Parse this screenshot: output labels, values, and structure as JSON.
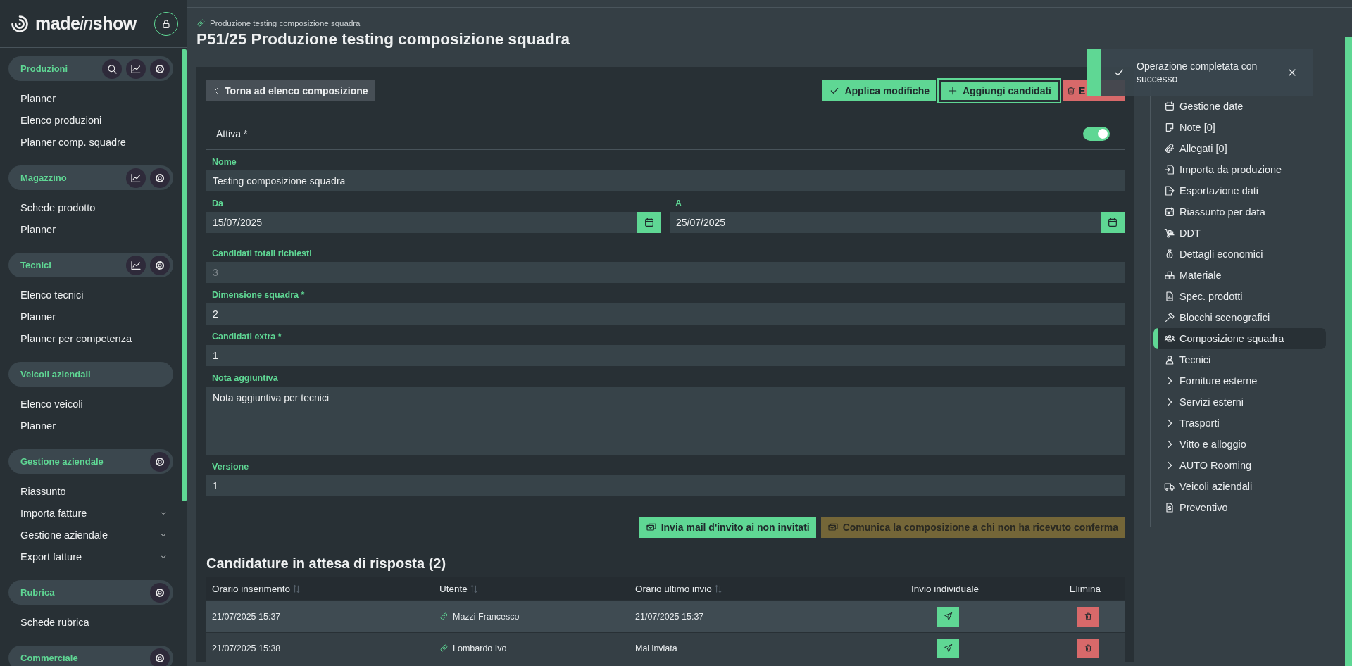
{
  "sidebar": {
    "logo": [
      {
        "text": "made",
        "italic": false
      },
      {
        "text": "in",
        "italic": true
      },
      {
        "text": "show",
        "italic": false
      }
    ],
    "sections": [
      {
        "title": "Produzioni",
        "actions": [
          {
            "kind": "search"
          },
          {
            "kind": "chart"
          },
          {
            "kind": "settings"
          }
        ],
        "items": [
          {
            "label": "Planner",
            "expandable": false
          },
          {
            "label": "Elenco produzioni",
            "expandable": false
          },
          {
            "label": "Planner comp. squadre",
            "expandable": false
          }
        ]
      },
      {
        "title": "Magazzino",
        "actions": [
          {
            "kind": "chart"
          },
          {
            "kind": "settings"
          }
        ],
        "items": [
          {
            "label": "Schede prodotto",
            "expandable": false
          },
          {
            "label": "Planner",
            "expandable": false
          }
        ]
      },
      {
        "title": "Tecnici",
        "actions": [
          {
            "kind": "chart"
          },
          {
            "kind": "settings"
          }
        ],
        "items": [
          {
            "label": "Elenco tecnici",
            "expandable": false
          },
          {
            "label": "Planner",
            "expandable": false
          },
          {
            "label": "Planner per competenza",
            "expandable": false
          }
        ]
      },
      {
        "title": "Veicoli aziendali",
        "items": [
          {
            "label": "Elenco veicoli",
            "expandable": false
          },
          {
            "label": "Planner",
            "expandable": false
          }
        ]
      },
      {
        "title": "Gestione aziendale",
        "actions": [
          {
            "kind": "settings"
          }
        ],
        "items": [
          {
            "label": "Riassunto",
            "expandable": false
          },
          {
            "label": "Importa fatture",
            "expandable": true
          },
          {
            "label": "Gestione aziendale",
            "expandable": true
          },
          {
            "label": "Export fatture",
            "expandable": true
          }
        ]
      },
      {
        "title": "Rubrica",
        "actions": [
          {
            "kind": "settings"
          }
        ],
        "items": [
          {
            "label": "Schede rubrica",
            "expandable": false
          }
        ]
      },
      {
        "title": "Commerciale",
        "actions": [
          {
            "kind": "settings"
          }
        ]
      }
    ]
  },
  "breadcrumb": "Produzione testing composizione squadra",
  "title": "P51/25 Produzione testing composizione squadra",
  "back_button": "Torna ad elenco composizione",
  "actions": [
    {
      "kind": "apply",
      "label": "Applica modifiche"
    },
    {
      "kind": "add",
      "label": "Aggiungi candidati"
    },
    {
      "kind": "delete",
      "label": "E"
    }
  ],
  "toggle": {
    "label": "Attiva *",
    "on": true
  },
  "fields": [
    {
      "kind": "text",
      "label": "Nome",
      "value": "Testing composizione squadra",
      "disabled": false
    },
    {
      "kind": "dates",
      "items": [
        {
          "label": "Da",
          "value": "15/07/2025"
        },
        {
          "label": "A",
          "value": "25/07/2025"
        }
      ]
    },
    {
      "kind": "text",
      "label": "Candidati totali richiesti",
      "value": "3",
      "disabled": true
    },
    {
      "kind": "text",
      "label": "Dimensione squadra *",
      "value": "2",
      "disabled": false
    },
    {
      "kind": "text",
      "label": "Candidati extra *",
      "value": "1",
      "disabled": false
    },
    {
      "kind": "textarea",
      "label": "Nota aggiuntiva",
      "value": "Nota aggiuntiva per tecnici",
      "disabled": false
    },
    {
      "kind": "text",
      "label": "Versione",
      "value": "1",
      "disabled": false
    }
  ],
  "mail_buttons": [
    {
      "kind": "invite",
      "label": "Invia mail d'invito ai non invitati"
    },
    {
      "kind": "notify",
      "label": "Comunica la composizione a chi non ha ricevuto conferma"
    }
  ],
  "table": {
    "title": "Candidature in attesa di risposta (2)",
    "columns": [
      {
        "label": "Orario inserimento",
        "sortable": true
      },
      {
        "label": "Utente",
        "sortable": true
      },
      {
        "label": "Orario ultimo invio",
        "sortable": true
      },
      {
        "label": "Invio individuale",
        "sortable": false
      },
      {
        "label": "Elimina",
        "sortable": false
      }
    ],
    "rows": [
      {
        "inserted": "21/07/2025 15:37",
        "user": "Mazzi Francesco",
        "last_sent": "21/07/2025 15:37",
        "hovered": true
      },
      {
        "inserted": "21/07/2025 15:38",
        "user": "Lombardo Ivo",
        "last_sent": "Mai inviata",
        "hovered": false
      }
    ]
  },
  "side_nav": [
    {
      "kind": "page",
      "label": "Gestione date",
      "selected": false
    },
    {
      "kind": "page",
      "label": "Note [0]",
      "selected": false
    },
    {
      "kind": "page",
      "label": "Allegati [0]",
      "selected": false
    },
    {
      "kind": "page",
      "label": "Importa da produzione",
      "selected": false
    },
    {
      "kind": "page",
      "label": "Esportazione dati",
      "selected": false
    },
    {
      "kind": "page",
      "label": "Riassunto per data",
      "selected": false
    },
    {
      "kind": "page",
      "label": "DDT",
      "selected": false
    },
    {
      "kind": "page",
      "label": "Dettagli economici",
      "selected": false
    },
    {
      "kind": "page",
      "label": "Materiale",
      "selected": false
    },
    {
      "kind": "page",
      "label": "Spec. prodotti",
      "selected": false
    },
    {
      "kind": "page",
      "label": "Blocchi scenografici",
      "selected": false
    },
    {
      "kind": "page",
      "label": "Composizione squadra",
      "selected": true
    },
    {
      "kind": "page",
      "label": "Tecnici",
      "selected": false
    },
    {
      "kind": "group",
      "label": "Forniture esterne",
      "selected": false
    },
    {
      "kind": "group",
      "label": "Servizi esterni",
      "selected": false
    },
    {
      "kind": "group",
      "label": "Trasporti",
      "selected": false
    },
    {
      "kind": "group",
      "label": "Vitto e alloggio",
      "selected": false
    },
    {
      "kind": "group",
      "label": "AUTO Rooming",
      "selected": false
    },
    {
      "kind": "page",
      "label": "Veicoli aziendali",
      "selected": false
    },
    {
      "kind": "page",
      "label": "Preventivo",
      "selected": false
    }
  ],
  "toast": {
    "kind": "success",
    "message": "Operazione completata con successo"
  }
}
